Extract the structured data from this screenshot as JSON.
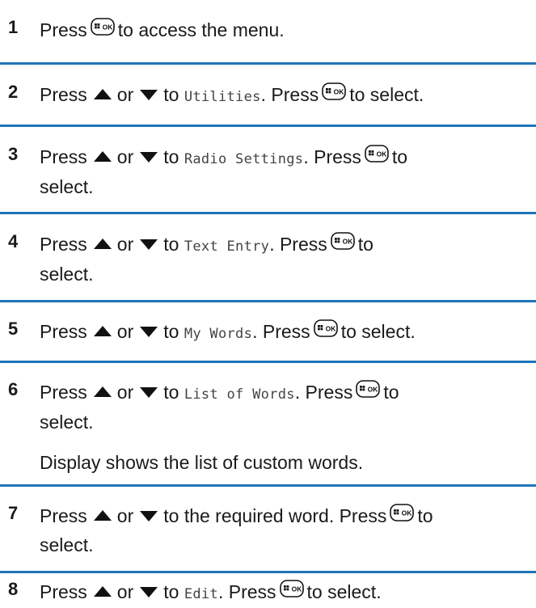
{
  "steps": [
    {
      "number": "1",
      "segments": [
        "Press",
        "to access the menu."
      ]
    },
    {
      "number": "2",
      "segments": [
        "Press",
        "or",
        "to",
        "Utilities",
        ". Press",
        "to select."
      ]
    },
    {
      "number": "3",
      "segments": [
        "Press",
        "or",
        "to",
        "Radio Settings",
        ". Press",
        "to",
        "select."
      ]
    },
    {
      "number": "4",
      "segments": [
        "Press",
        "or",
        "to",
        "Text Entry",
        ". Press",
        "to",
        "select."
      ]
    },
    {
      "number": "5",
      "segments": [
        "Press",
        "or",
        "to",
        "My Words",
        ". Press",
        "to select."
      ]
    },
    {
      "number": "6",
      "segments": [
        "Press",
        "or",
        "to",
        "List of Words",
        ". Press",
        "to",
        "select."
      ],
      "result": "Display shows the list of custom words."
    },
    {
      "number": "7",
      "segments": [
        "Press",
        "or",
        "to the required word. Press",
        "to",
        "select."
      ]
    },
    {
      "number": "8",
      "segments": [
        "Press",
        "or",
        "to",
        "Edit",
        ". Press",
        "to select."
      ]
    }
  ],
  "key_icon_label": "OK",
  "colors": {
    "rule": "#1e74b8",
    "text": "#1a1a1a",
    "ui_text": "#444444",
    "icon": "#111111"
  },
  "icons": [
    "up-arrow-icon",
    "down-arrow-icon",
    "menu-ok-key-icon"
  ]
}
